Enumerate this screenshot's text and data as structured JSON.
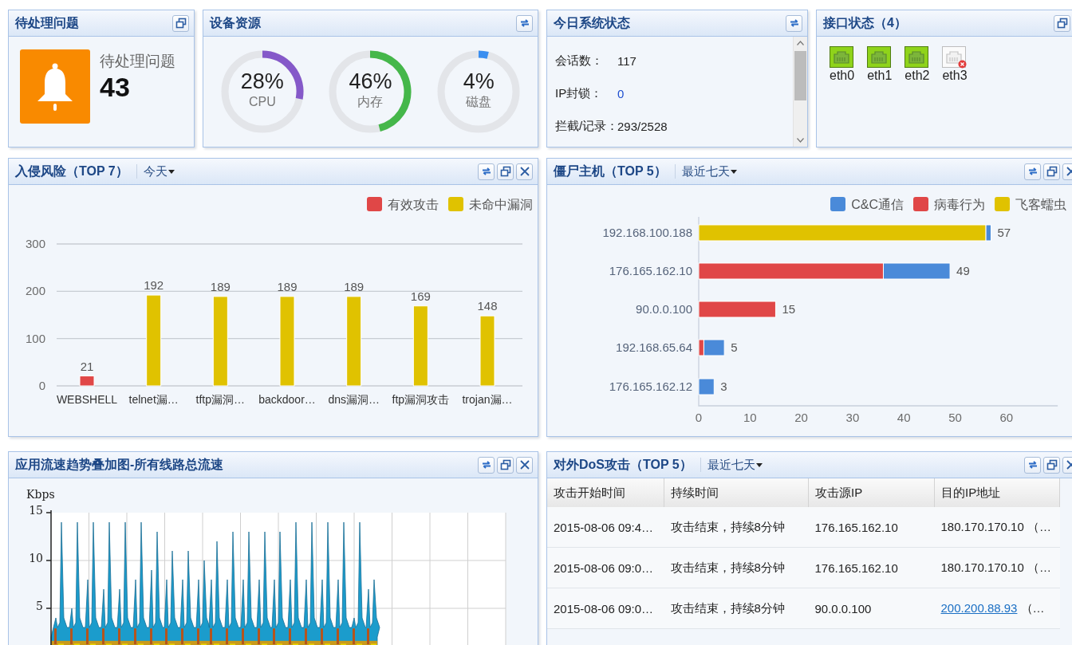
{
  "pending": {
    "title": "待处理问题",
    "tools": [
      {
        "kind": "restore"
      }
    ],
    "label": "待处理问题",
    "count": "43"
  },
  "resources": {
    "title": "设备资源",
    "tools": [
      {
        "kind": "refresh"
      }
    ],
    "gauges": [
      {
        "value": "28%",
        "label": "CPU",
        "color": "#8559c9"
      },
      {
        "value": "46%",
        "label": "内存",
        "color": "#45b74a"
      },
      {
        "value": "4%",
        "label": "磁盘",
        "color": "#3a8ef0"
      }
    ]
  },
  "system_status": {
    "title": "今日系统状态",
    "tools": [
      {
        "kind": "refresh"
      }
    ],
    "items": [
      {
        "label": "会话数：",
        "value": "117",
        "link": false
      },
      {
        "label": "IP封锁：",
        "value": "0",
        "link": true
      },
      {
        "label": "拦截/记录：",
        "value": "293/2528",
        "link": false
      }
    ]
  },
  "interfaces": {
    "title": "接口状态（4）",
    "tools": [
      {
        "kind": "restore"
      }
    ],
    "ports": [
      {
        "name": "eth0",
        "connected": true
      },
      {
        "name": "eth1",
        "connected": true
      },
      {
        "name": "eth2",
        "connected": true
      },
      {
        "name": "eth3",
        "connected": false
      }
    ]
  },
  "intrusion": {
    "title": "入侵风险（TOP 7）",
    "range": "今天",
    "tools": [
      {
        "kind": "refresh"
      },
      {
        "kind": "restore"
      },
      {
        "kind": "close"
      }
    ],
    "chart_data": {
      "type": "bar",
      "legend": "top-right",
      "categories": [
        "WEBSHELL",
        "telnet漏…",
        "tftp漏洞…",
        "backdoor…",
        "dns漏洞…",
        "ftp漏洞攻击",
        "trojan漏…"
      ],
      "series": [
        {
          "name": "有效攻击",
          "color": "#e04747",
          "values": [
            21,
            null,
            null,
            null,
            null,
            null,
            null
          ]
        },
        {
          "name": "未命中漏洞",
          "color": "#e0c200",
          "values": [
            null,
            192,
            189,
            189,
            189,
            169,
            148
          ]
        }
      ],
      "ylim": [
        0,
        300
      ],
      "yticks": [
        0,
        100,
        200,
        300
      ],
      "data_labels": true
    }
  },
  "zombies": {
    "title": "僵尸主机（TOP 5）",
    "range": "最近七天",
    "tools": [
      {
        "kind": "refresh"
      },
      {
        "kind": "restore"
      },
      {
        "kind": "close"
      }
    ],
    "chart_data": {
      "type": "bar",
      "legend": "top-right",
      "orientation": "horizontal",
      "stacked": true,
      "categories": [
        "192.168.100.188",
        "176.165.162.10",
        "90.0.0.100",
        "192.168.65.64",
        "176.165.162.12"
      ],
      "series": [
        {
          "name": "C&C通信",
          "color": "#4a8ad9",
          "values": [
            1,
            13,
            null,
            4,
            3
          ]
        },
        {
          "name": "病毒行为",
          "color": "#e04747",
          "values": [
            null,
            36,
            15,
            1,
            null
          ]
        },
        {
          "name": "飞客蠕虫",
          "color": "#e0c200",
          "values": [
            56,
            null,
            null,
            null,
            null
          ]
        }
      ],
      "xlim": [
        0,
        70
      ],
      "xticks": [
        0,
        10,
        20,
        30,
        40,
        50,
        60
      ],
      "value_labels": [
        "57",
        "49",
        "15",
        "5",
        "3"
      ]
    }
  },
  "traffic": {
    "title": "应用流速趋势叠加图-所有线路总流速",
    "tools": [
      {
        "kind": "refresh"
      },
      {
        "kind": "restore"
      },
      {
        "kind": "close"
      }
    ],
    "y_unit": "Kbps",
    "y_ticks": [
      "15",
      "10",
      "5"
    ]
  },
  "dos": {
    "title": "对外DoS攻击（TOP 5）",
    "range": "最近七天",
    "tools": [
      {
        "kind": "refresh"
      },
      {
        "kind": "restore"
      },
      {
        "kind": "close"
      }
    ],
    "columns": [
      "攻击开始时间",
      "持续时间",
      "攻击源IP",
      "目的IP地址"
    ],
    "rows": [
      {
        "start": "2015-08-06 09:4…",
        "duration": "攻击结束，持续8分钟",
        "source": "176.165.162.10",
        "destination": {
          "ip": "180.170.170.10",
          "rest": "（…",
          "link": false
        }
      },
      {
        "start": "2015-08-06 09:0…",
        "duration": "攻击结束，持续8分钟",
        "source": "176.165.162.10",
        "destination": {
          "ip": "180.170.170.10",
          "rest": "（…",
          "link": false
        }
      },
      {
        "start": "2015-08-06 09:0…",
        "duration": "攻击结束，持续8分钟",
        "source": "90.0.0.100",
        "destination": {
          "ip": "200.200.88.93",
          "rest": "（…",
          "link": true
        }
      }
    ]
  }
}
